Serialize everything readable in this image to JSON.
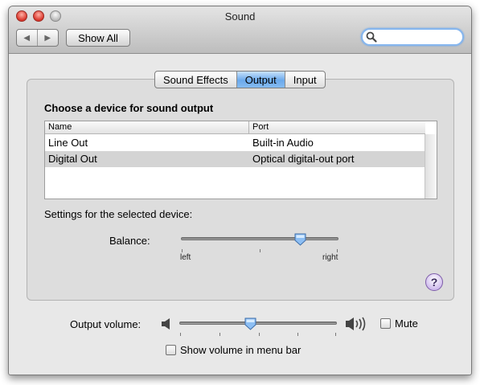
{
  "window": {
    "title": "Sound"
  },
  "toolbar": {
    "show_all_label": "Show All",
    "back_icon": "back-arrow-icon",
    "forward_icon": "forward-arrow-icon",
    "search_placeholder": ""
  },
  "tabs": [
    {
      "label": "Sound Effects",
      "selected": false
    },
    {
      "label": "Output",
      "selected": true
    },
    {
      "label": "Input",
      "selected": false
    }
  ],
  "output": {
    "heading": "Choose a device for sound output",
    "columns": [
      "Name",
      "Port"
    ],
    "devices": [
      {
        "name": "Line Out",
        "port": "Built-in Audio",
        "selected": false
      },
      {
        "name": "Digital Out",
        "port": "Optical digital-out port",
        "selected": true
      }
    ],
    "settings_label": "Settings for the selected device:",
    "balance": {
      "label": "Balance:",
      "left_label": "left",
      "right_label": "right",
      "value": 0.76
    }
  },
  "help": {
    "symbol": "?"
  },
  "volume": {
    "label": "Output volume:",
    "value": 0.45,
    "mute_label": "Mute",
    "mute_checked": false,
    "show_in_menubar_label": "Show volume in menu bar",
    "show_in_menubar_checked": false
  },
  "colors": {
    "selection": "#d4d4d4",
    "tab_active": "#6aa9ec",
    "search_focus": "#86b6ee"
  }
}
